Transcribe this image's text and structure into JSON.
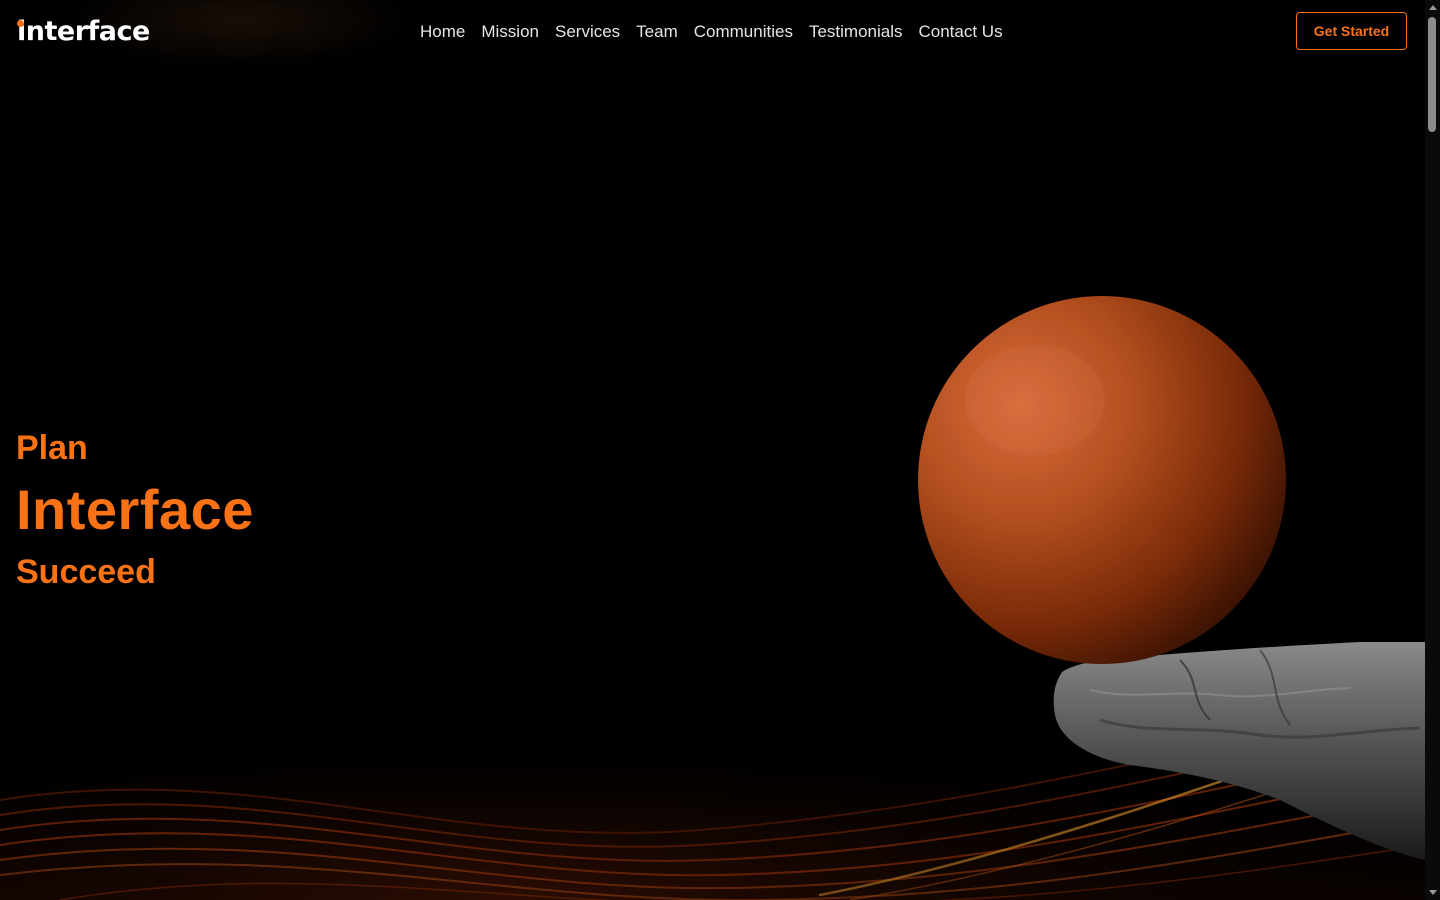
{
  "brand": {
    "name": "interface",
    "accent": "#f97316"
  },
  "nav": {
    "links": [
      "Home",
      "Mission",
      "Services",
      "Team",
      "Communities",
      "Testimonials",
      "Contact Us"
    ],
    "cta_label": "Get Started"
  },
  "hero": {
    "line1": "Plan",
    "line2": "Interface",
    "line3": "Succeed"
  },
  "decor": {
    "sphere_color": "#a0400f",
    "rock_color": "#5a5a5a",
    "wave_color": "#c2410c"
  }
}
